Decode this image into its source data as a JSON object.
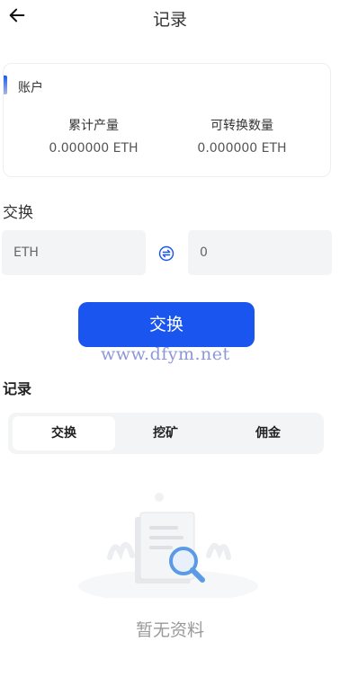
{
  "header": {
    "title": "记录",
    "back_icon": "arrow-left-icon"
  },
  "account_card": {
    "title": "账户",
    "stats": [
      {
        "label": "累计产量",
        "value": "0.000000 ETH"
      },
      {
        "label": "可转换数量",
        "value": "0.000000 ETH"
      }
    ]
  },
  "exchange": {
    "section_label": "交换",
    "from_value": "ETH",
    "to_value": "0",
    "swap_icon": "swap-icon",
    "button_label": "交换"
  },
  "watermark": "www.dfym.net",
  "records": {
    "label": "记录",
    "tabs": [
      "交换",
      "挖矿",
      "佣金"
    ],
    "active_tab": 0
  },
  "empty_state": {
    "text": "暂无资料",
    "icon": "document-search-icon"
  },
  "colors": {
    "accent": "#1b55f0",
    "field_bg": "#f3f4f6",
    "muted_text": "#9a9a9a"
  }
}
